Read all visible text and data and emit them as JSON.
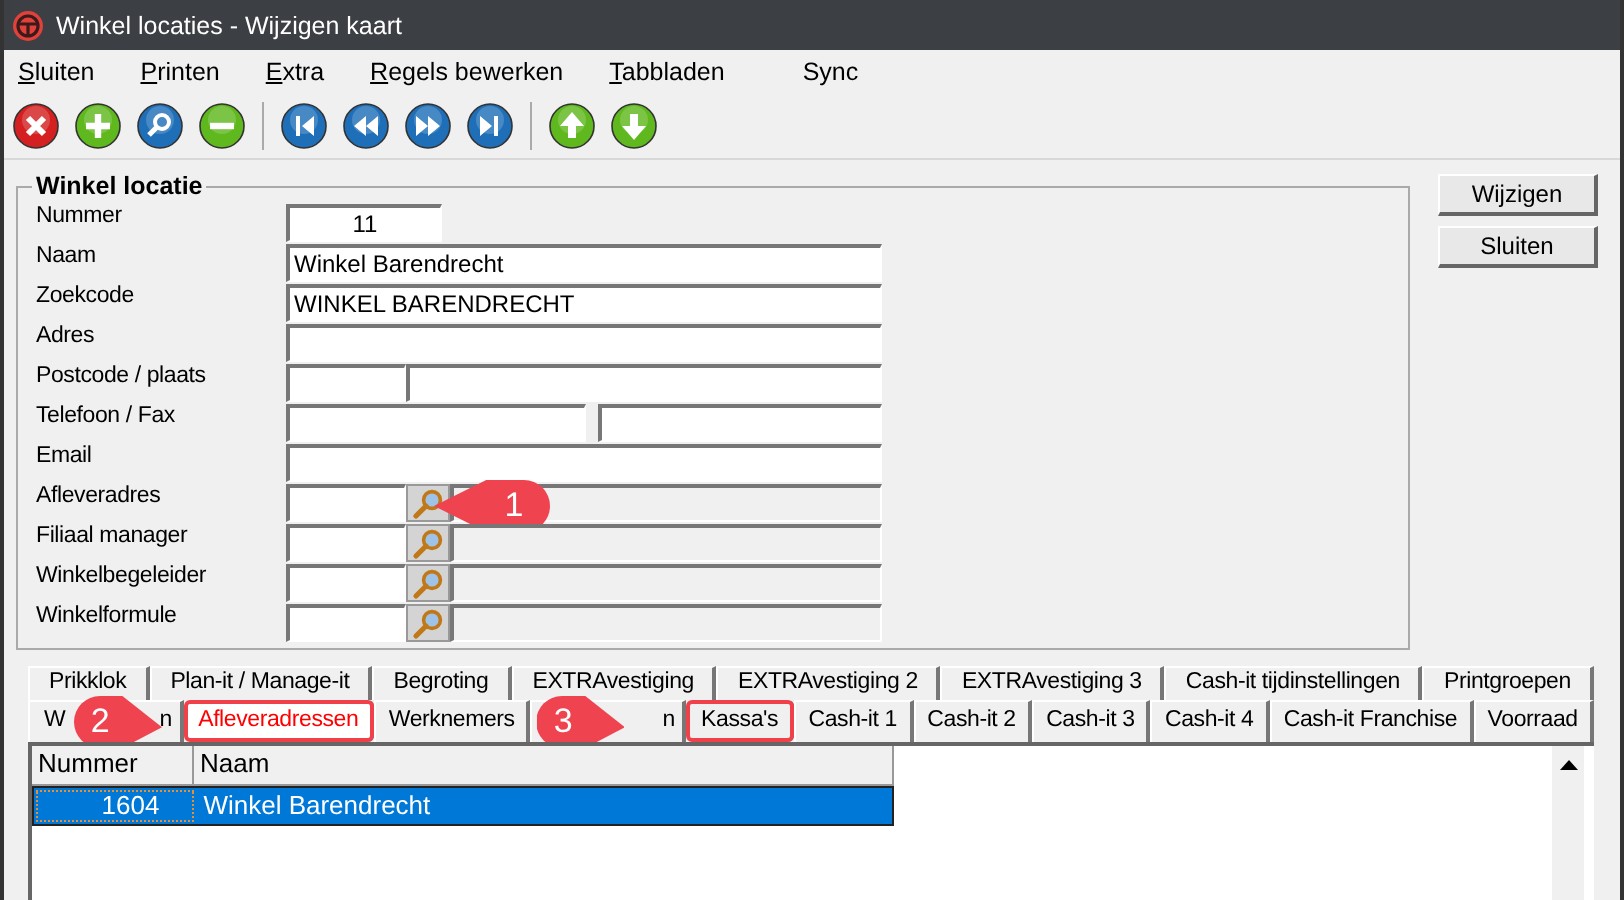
{
  "window": {
    "title": "Winkel locaties - Wijzigen kaart"
  },
  "menu": [
    {
      "label": "Sluiten",
      "mnemonic": true
    },
    {
      "label": "Printen",
      "mnemonic": true
    },
    {
      "label": "Extra",
      "mnemonic": true
    },
    {
      "label": "Regels bewerken",
      "mnemonic": true
    },
    {
      "label": "Tabbladen",
      "mnemonic": true
    },
    {
      "label": "Sync",
      "mnemonic": false
    }
  ],
  "group": {
    "title": "Winkel locatie",
    "fields": [
      {
        "kind": "short",
        "label": "Nummer",
        "value": "11"
      },
      {
        "kind": "text",
        "label": "Naam",
        "value": "Winkel Barendrecht"
      },
      {
        "kind": "text",
        "label": "Zoekcode",
        "value": "WINKEL BARENDRECHT"
      },
      {
        "kind": "text",
        "label": "Adres"
      },
      {
        "kind": "postcode",
        "label": "Postcode / plaats"
      },
      {
        "kind": "phone",
        "label": "Telefoon / Fax"
      },
      {
        "kind": "text",
        "label": "Email"
      },
      {
        "kind": "lookup",
        "label": "Afleveradres",
        "callout": "1"
      },
      {
        "kind": "lookup",
        "label": "Filiaal manager"
      },
      {
        "kind": "lookup",
        "label": "Winkelbegeleider"
      },
      {
        "kind": "lookup",
        "label": "Winkelformule"
      }
    ]
  },
  "buttons": [
    "Wijzigen",
    "Sluiten"
  ],
  "tab_rows": [
    [
      {
        "label": "Prikklok",
        "selected": false
      },
      {
        "label": "Plan-it / Manage-it",
        "selected": false
      },
      {
        "label": "Begroting",
        "selected": false
      },
      {
        "label": "EXTRAvestiging",
        "selected": false
      },
      {
        "label": "EXTRAvestiging 2",
        "selected": false
      },
      {
        "label": "EXTRAvestiging 3",
        "selected": false
      },
      {
        "label": "Cash-it tijdinstellingen",
        "selected": false
      },
      {
        "label": "Printgroepen",
        "selected": false
      }
    ],
    [
      {
        "label_parts": [
          "W",
          "n"
        ],
        "callout": "2",
        "selected": false
      },
      {
        "label": "Afleveradressen",
        "selected": true,
        "highlighted": true
      },
      {
        "label": "Werknemers",
        "selected": false
      },
      {
        "label_parts": [
          "n"
        ],
        "callout": "3",
        "selected": false
      },
      {
        "label": "Kassa's",
        "selected": false,
        "highlighted": true
      },
      {
        "label": "Cash-it 1",
        "selected": false
      },
      {
        "label": "Cash-it 2",
        "selected": false
      },
      {
        "label": "Cash-it 3",
        "selected": false
      },
      {
        "label": "Cash-it 4",
        "selected": false
      },
      {
        "label": "Cash-it Franchise",
        "selected": false
      },
      {
        "label": "Voorraad",
        "selected": false
      }
    ]
  ],
  "grid": {
    "columns": [
      "Nummer",
      "Naam"
    ],
    "rows": [
      {
        "cells": [
          "1604",
          "Winkel Barendrecht"
        ],
        "selected": true
      }
    ]
  }
}
